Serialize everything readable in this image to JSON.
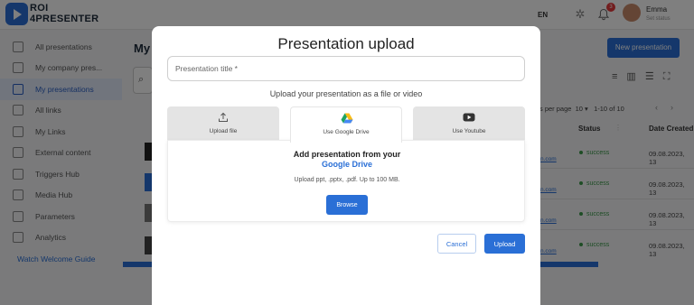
{
  "app": {
    "logo_line1": "ROI",
    "logo_line2": "4PRESENTER",
    "language": "EN",
    "notification_count": "3",
    "user_name": "Emma",
    "user_status": "Set status"
  },
  "sidebar": {
    "items": [
      {
        "label": "All presentations",
        "icon": "presentation-icon"
      },
      {
        "label": "My company pres...",
        "icon": "presentation-icon"
      },
      {
        "label": "My presentations",
        "icon": "presentation-icon",
        "active": true
      },
      {
        "label": "All links",
        "icon": "link-icon"
      },
      {
        "label": "My Links",
        "icon": "user-link-icon"
      },
      {
        "label": "External content",
        "icon": "document-icon"
      },
      {
        "label": "Triggers Hub",
        "icon": "lightning-icon"
      },
      {
        "label": "Media Hub",
        "icon": "image-icon"
      },
      {
        "label": "Parameters",
        "icon": "cloud-icon"
      },
      {
        "label": "Analytics",
        "icon": "chart-icon"
      }
    ],
    "guide_label": "Watch Welcome Guide"
  },
  "main": {
    "title": "My p",
    "new_button": "New presentation",
    "rows_per_page_label": "s per page",
    "rows_per_page_value": "10",
    "range": "1-10 of 10",
    "columns": {
      "status": "Status",
      "date": "Date Created"
    },
    "rows": [
      {
        "link": "n.com",
        "status": "success",
        "date": "09.08.2023, 13"
      },
      {
        "link": "n.com",
        "status": "success",
        "date": "09.08.2023, 13"
      },
      {
        "link": "n.com",
        "status": "success",
        "date": "09.08.2023, 13"
      },
      {
        "link": "n.com",
        "status": "success",
        "date": "09.08.2023, 13"
      }
    ]
  },
  "modal": {
    "title": "Presentation upload",
    "input_placeholder": "Presentation title *",
    "subtitle": "Upload your presentation as a file or video",
    "tabs": [
      {
        "label": "Upload file",
        "icon": "upload-icon"
      },
      {
        "label": "Use Google Drive",
        "icon": "google-drive-icon",
        "active": true
      },
      {
        "label": "Use Youtube",
        "icon": "youtube-icon"
      }
    ],
    "panel_heading": "Add presentation from your",
    "panel_link": "Google Drive",
    "panel_note": "Upload ppt, .pptx, .pdf. Up to 100 MB.",
    "browse_label": "Browse",
    "cancel_label": "Cancel",
    "upload_label": "Upload"
  },
  "colors": {
    "accent": "#2a6fd6",
    "success": "#3c9a4a",
    "badge": "#e5393b"
  }
}
